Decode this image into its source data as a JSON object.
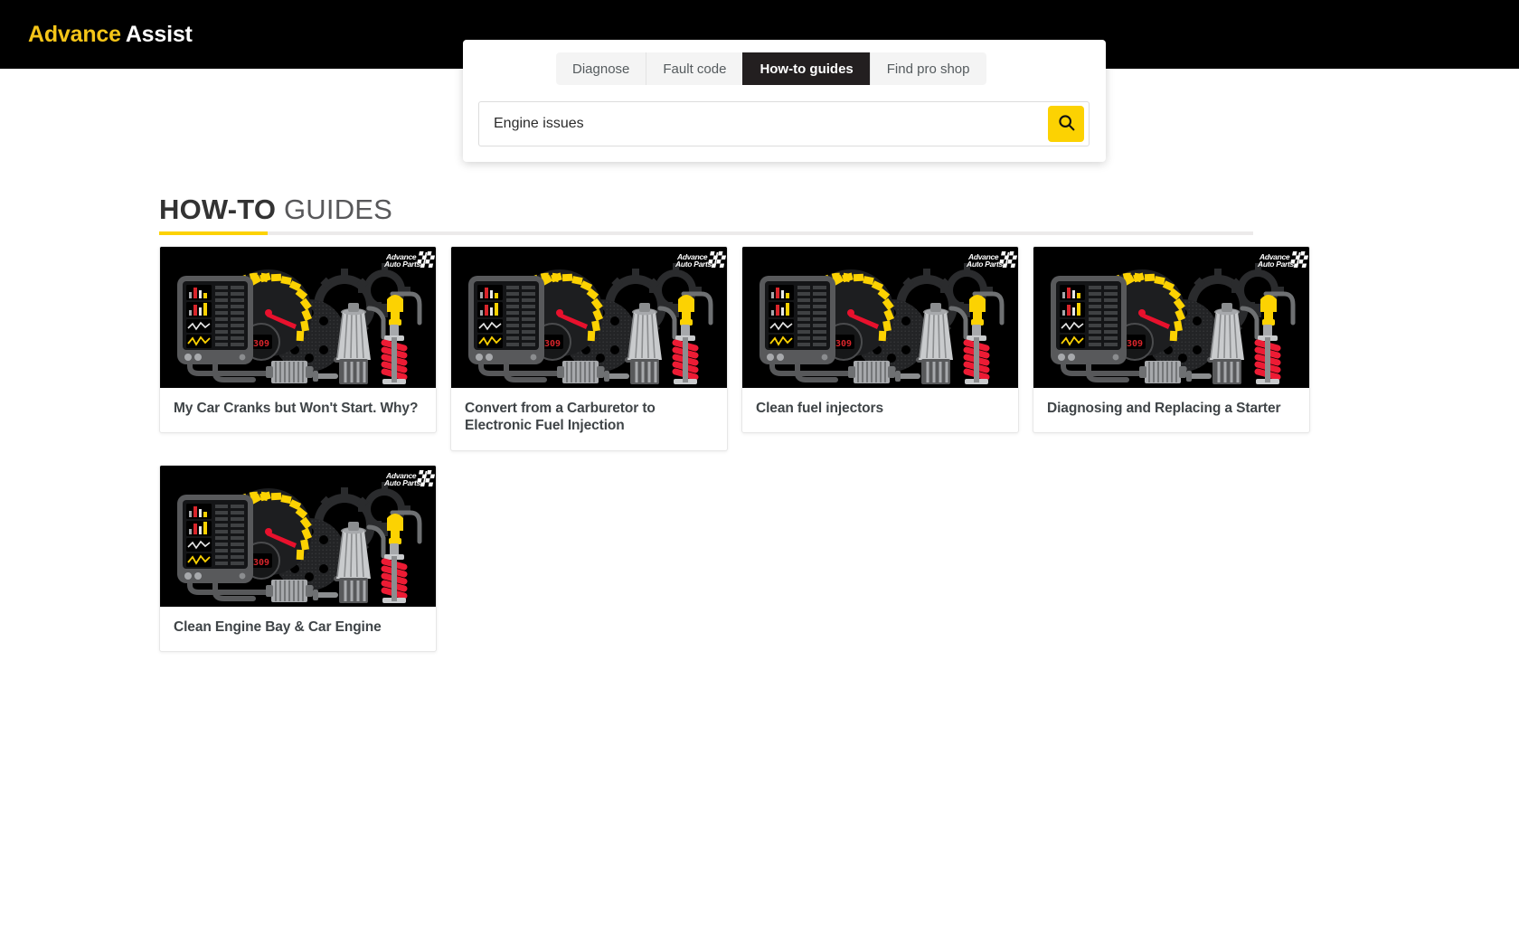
{
  "header": {
    "brand_primary": "Advance",
    "brand_secondary": "Assist"
  },
  "search_panel": {
    "tabs": [
      {
        "label": "Diagnose",
        "active": false
      },
      {
        "label": "Fault code",
        "active": false
      },
      {
        "label": "How-to guides",
        "active": true
      },
      {
        "label": "Find pro shop",
        "active": false
      }
    ],
    "input": {
      "value": "Engine issues",
      "placeholder": "Search"
    },
    "search_button_icon": "search-icon",
    "accent_color": "#fcd202"
  },
  "section": {
    "title_strong": "HOW-TO",
    "title_light": "GUIDES",
    "accent_color": "#fcd202",
    "rule_color": "#eceaea"
  },
  "guides": [
    {
      "title": "My Car Cranks but Won't Start. Why?",
      "image_alt": "advance-auto-parts-diagnostic-illustration",
      "logo": "Advance Auto Parts"
    },
    {
      "title": "Convert from a Carburetor to Electronic Fuel Injection",
      "image_alt": "advance-auto-parts-diagnostic-illustration",
      "logo": "Advance Auto Parts"
    },
    {
      "title": "Clean fuel injectors",
      "image_alt": "advance-auto-parts-diagnostic-illustration",
      "logo": "Advance Auto Parts"
    },
    {
      "title": "Diagnosing and Replacing a Starter",
      "image_alt": "advance-auto-parts-diagnostic-illustration",
      "logo": "Advance Auto Parts"
    },
    {
      "title": "Clean Engine Bay & Car Engine",
      "image_alt": "advance-auto-parts-diagnostic-illustration",
      "logo": "Advance Auto Parts"
    }
  ],
  "illustration": {
    "gauge_display_value": "309",
    "colors": {
      "background": "#000000",
      "gauge_yellow": "#fcd202",
      "needle_red": "#e8112d",
      "metal_gray": "#58595b",
      "light_gray": "#a7a9ac",
      "spring_red": "#ed1b34"
    }
  }
}
